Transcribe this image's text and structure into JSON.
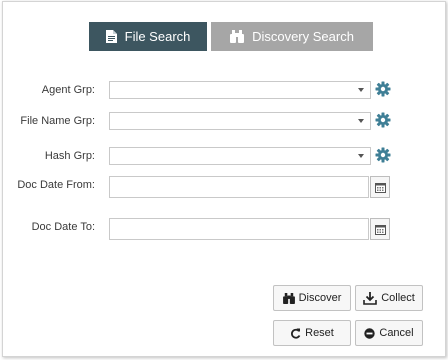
{
  "tabs": [
    {
      "label": "File Search",
      "icon": "document-icon",
      "active": true
    },
    {
      "label": "Discovery Search",
      "icon": "binoculars-icon",
      "active": false
    }
  ],
  "form": {
    "agent_grp": {
      "label": "Agent Grp:",
      "value": ""
    },
    "file_name_grp": {
      "label": "File Name Grp:",
      "value": ""
    },
    "hash_grp": {
      "label": "Hash Grp:",
      "value": ""
    },
    "doc_date_from": {
      "label": "Doc Date From:",
      "value": ""
    },
    "doc_date_to": {
      "label": "Doc Date To:",
      "value": ""
    }
  },
  "buttons": {
    "discover": "Discover",
    "collect": "Collect",
    "reset": "Reset",
    "cancel": "Cancel"
  },
  "colors": {
    "active_tab": "#3d5660",
    "inactive_tab": "#a6a6a6",
    "gear": "#3f7f96"
  }
}
